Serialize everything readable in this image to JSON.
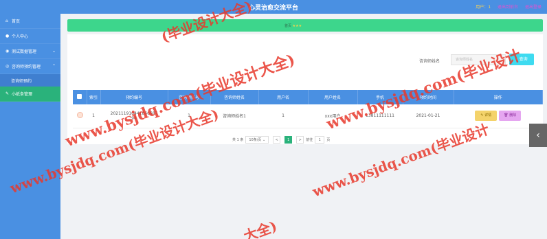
{
  "header": {
    "title": "心灵治愈交流平台",
    "user_label": "用户：",
    "user_name": "1",
    "link_home": "退出到前台",
    "link_logout": "退出登录"
  },
  "sidebar": {
    "items": [
      {
        "label": "首页",
        "icon": "home-icon"
      },
      {
        "label": "个人中心",
        "icon": "user-icon"
      },
      {
        "label": "测试数据管理",
        "icon": "data-icon"
      },
      {
        "label": "咨询师预约管理",
        "icon": "calendar-icon"
      },
      {
        "label": "咨询师预约",
        "icon": ""
      },
      {
        "label": "小纸条管理",
        "icon": "note-icon"
      }
    ]
  },
  "banner": {
    "text": "首页",
    "stars": "★★★"
  },
  "search": {
    "label": "咨询师姓名",
    "placeholder": "咨询师姓名",
    "button": "查询"
  },
  "table": {
    "headers": [
      "索引",
      "预约编号",
      "咨询师账号",
      "咨询师姓名",
      "用户名",
      "用户姓名",
      "手机",
      "预约时间",
      "操作"
    ],
    "rows": [
      {
        "index": "1",
        "booking_no_1": "202111910441866687",
        "booking_no_2": "94",
        "counselor_account": "1",
        "counselor_name": "咨询师姓名1",
        "username": "1",
        "user_name": "xxx用户",
        "phone": "13811111111",
        "time": "2021-01-21",
        "btn_detail": "详情",
        "btn_delete": "删除"
      }
    ]
  },
  "pager": {
    "total": "共 1 条",
    "page_size": "10条/页",
    "prev": "<",
    "current": "1",
    "next": ">",
    "goto": "前往",
    "goto_value": "1",
    "page_unit": "页"
  },
  "watermark": {
    "text": "www.bysjdq.com(毕业设计大全)",
    "partial_left_top": "(毕业设计大全)",
    "partial_right": "www.bysjdq.com(毕业设计",
    "partial_bottom": "大全)"
  },
  "colors": {
    "sidebar": "#4a90e2",
    "active": "#2ab27b",
    "banner": "#3dd68c",
    "watermark": "#e8392c"
  }
}
